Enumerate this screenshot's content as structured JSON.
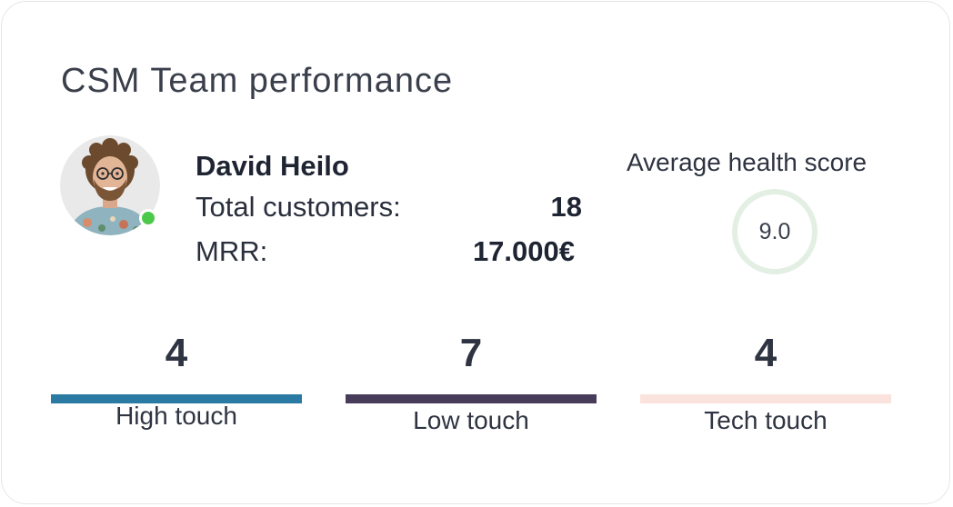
{
  "card": {
    "title": "CSM Team performance"
  },
  "csm": {
    "name": "David Heilo",
    "avatar_icon": "avatar-photo",
    "status": "online",
    "status_color": "#4cc94a",
    "total_customers_label": "Total customers:",
    "total_customers_value": "18",
    "mrr_label": "MRR:",
    "mrr_value": "17.000€"
  },
  "health": {
    "label": "Average health score",
    "value": "9.0",
    "ring_color": "#e3efe3"
  },
  "segments": [
    {
      "count": "4",
      "label": "High touch",
      "color": "#2a7aa3"
    },
    {
      "count": "7",
      "label": "Low touch",
      "color": "#473d5a"
    },
    {
      "count": "4",
      "label": "Tech touch",
      "color": "#fbe3dd"
    }
  ]
}
